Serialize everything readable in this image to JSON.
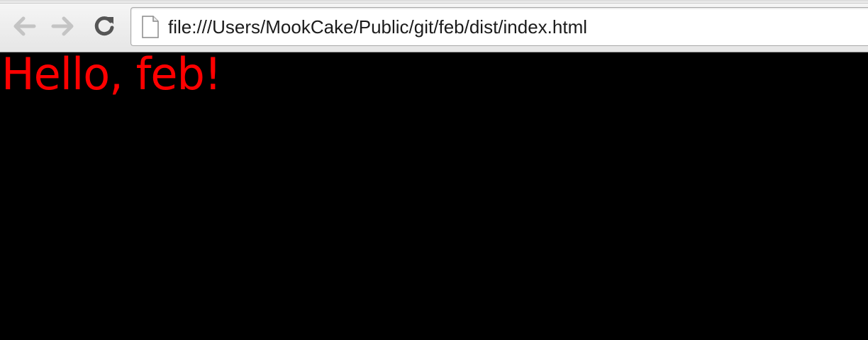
{
  "browser": {
    "url": "file:///Users/MookCake/Public/git/feb/dist/index.html",
    "icons": {
      "back": "arrow-left-icon",
      "forward": "arrow-right-icon",
      "reload": "reload-icon",
      "page": "document-icon"
    },
    "toolbar_color": "#ececec"
  },
  "page": {
    "heading": "Hello, feb!",
    "heading_color": "#ff0000",
    "background_color": "#000000"
  }
}
